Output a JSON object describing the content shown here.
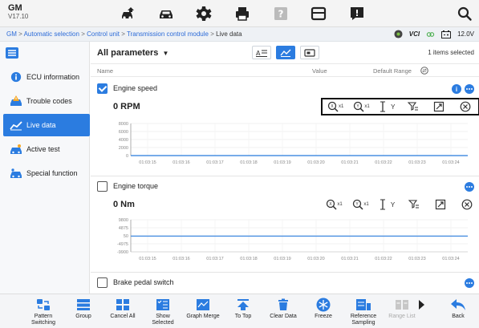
{
  "app": {
    "brand": "GM",
    "version": "V17.10"
  },
  "breadcrumb": {
    "items": [
      "GM",
      "Automatic selection",
      "Control unit",
      "Transmission control module",
      "Live data"
    ],
    "separator": ">"
  },
  "status": {
    "vci_label": "VCI",
    "battery": "12.0V"
  },
  "sidebar": {
    "items": [
      {
        "label": "ECU information",
        "icon": "info-icon",
        "active": false
      },
      {
        "label": "Trouble codes",
        "icon": "car-warning-icon",
        "active": false
      },
      {
        "label": "Live data",
        "icon": "line-graph-icon",
        "active": true
      },
      {
        "label": "Active test",
        "icon": "car-wrench-icon",
        "active": false
      },
      {
        "label": "Special function",
        "icon": "car-gear-icon",
        "active": false
      }
    ]
  },
  "params": {
    "title": "All parameters",
    "items_selected": "1 items selected",
    "columns": {
      "name": "Name",
      "value": "Value",
      "range": "Default Range"
    }
  },
  "rows": [
    {
      "name": "Engine speed",
      "checked": true,
      "value": "0 RPM",
      "y_ticks": [
        "8000",
        "6000",
        "4000",
        "2000",
        "0"
      ],
      "x_ticks": [
        "01:03:15",
        "01:03:16",
        "01:03:17",
        "01:03:18",
        "01:03:19",
        "01:03:20",
        "01:03:21",
        "01:03:22",
        "01:03:23",
        "01:03:24"
      ]
    },
    {
      "name": "Engine torque",
      "checked": false,
      "value": "0 Nm",
      "y_ticks": [
        "9800",
        "4875",
        "50",
        "-4975",
        "-9900"
      ],
      "x_ticks": [
        "01:03:15",
        "01:03:16",
        "01:03:17",
        "01:03:18",
        "01:03:19",
        "01:03:20",
        "01:03:21",
        "01:03:22",
        "01:03:23",
        "01:03:24"
      ]
    },
    {
      "name": "Brake pedal switch",
      "checked": false
    }
  ],
  "graph_tools": {
    "zoom_x": "x1",
    "zoom_y": "x1",
    "fit_y": "Y"
  },
  "bottom_toolbar": [
    {
      "label": "Pattern\nSwitching",
      "icon": "pattern-switch-icon",
      "enabled": true
    },
    {
      "label": "Group",
      "icon": "group-icon",
      "enabled": true
    },
    {
      "label": "Cancel All",
      "icon": "cancel-all-icon",
      "enabled": true
    },
    {
      "label": "Show\nSelected",
      "icon": "show-selected-icon",
      "enabled": true
    },
    {
      "label": "Graph Merge",
      "icon": "graph-merge-icon",
      "enabled": true
    },
    {
      "label": "To Top",
      "icon": "to-top-icon",
      "enabled": true
    },
    {
      "label": "Clear Data",
      "icon": "trash-icon",
      "enabled": true
    },
    {
      "label": "Freeze",
      "icon": "snowflake-icon",
      "enabled": true
    },
    {
      "label": "Reference\nSampling",
      "icon": "reference-sampling-icon",
      "enabled": true
    },
    {
      "label": "Range List",
      "icon": "range-list-icon",
      "enabled": false
    },
    {
      "label": "",
      "icon": "more-arrow-icon",
      "enabled": true
    },
    {
      "label": "Back",
      "icon": "back-icon",
      "enabled": true
    }
  ],
  "colors": {
    "accent": "#2b7ce0",
    "chart_line": "#4a90e2"
  }
}
